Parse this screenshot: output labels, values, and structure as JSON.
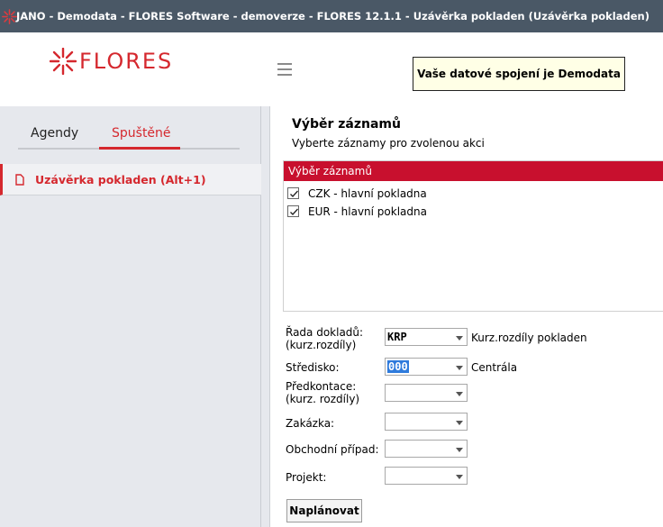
{
  "window": {
    "title": "JANO - Demodata - FLORES Software - demoverze - FLORES 12.1.1 - Uzávěrka pokladen  (Uzávěrka pokladen)",
    "icon": "flores-star-icon"
  },
  "header": {
    "logo_text": "FLORES",
    "menu_icon": "hamburger-icon",
    "connection_text": "Vaše datové spojení je Demodata"
  },
  "sidebar": {
    "tabs": [
      {
        "label": "Agendy",
        "active": false
      },
      {
        "label": "Spuštěné",
        "active": true
      }
    ],
    "running": [
      {
        "label": "Uzávěrka pokladen (Alt+1)",
        "icon": "document-icon"
      }
    ]
  },
  "main": {
    "title": "Výběr záznamů",
    "subtitle": "Vyberte záznamy pro zvolenou akci",
    "list": {
      "header": "Výběr záznamů",
      "items": [
        {
          "label": "CZK - hlavní pokladna",
          "checked": true
        },
        {
          "label": "EUR - hlavní pokladna",
          "checked": true
        }
      ]
    },
    "form": {
      "rada_label_1": "Řada dokladů:",
      "rada_label_2": "(kurz.rozdíly)",
      "rada_value": "KRP",
      "rada_desc": "Kurz.rozdíly pokladen",
      "stredisko_label": "Středisko:",
      "stredisko_value": "000",
      "stredisko_desc": "Centrála",
      "predkontace_label_1": "Předkontace:",
      "predkontace_label_2": "(kurz. rozdíly)",
      "predkontace_value": "",
      "zakazka_label": "Zakázka:",
      "zakazka_value": "",
      "obchodni_label": "Obchodní případ:",
      "obchodni_value": "",
      "projekt_label": "Projekt:",
      "projekt_value": ""
    },
    "plan_button": "Naplánovat"
  },
  "colors": {
    "accent": "#d5282e",
    "list_header": "#c8102e",
    "sidebar_bg": "#e6e8ed",
    "titlebar_bg": "#4a5866",
    "connection_bg": "#ffffe6"
  }
}
